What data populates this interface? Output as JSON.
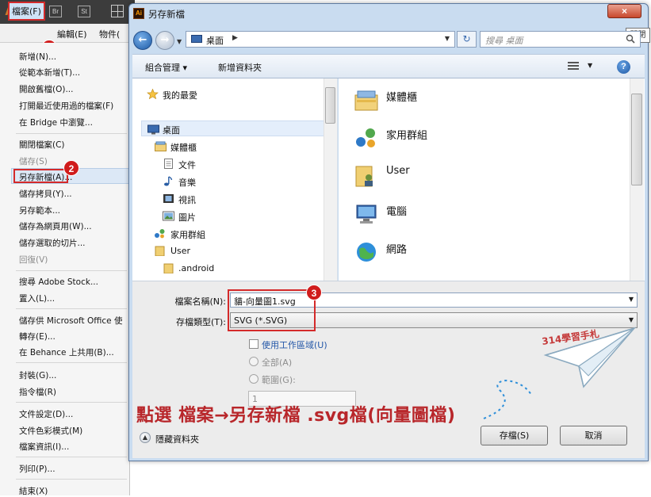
{
  "app": {
    "logo": "Ai",
    "badges": [
      "Br",
      "St"
    ],
    "menubar": [
      "檔案(F)",
      "編輯(E)",
      "物件("
    ]
  },
  "file_menu": {
    "items": [
      {
        "label": "新增(N)...",
        "enabled": true
      },
      {
        "label": "從範本新增(T)...",
        "enabled": true
      },
      {
        "label": "開啟舊檔(O)...",
        "enabled": true
      },
      {
        "label": "打開最近使用過的檔案(F)",
        "enabled": true
      },
      {
        "label": "在 Bridge 中瀏覽...",
        "enabled": true
      },
      {
        "label": "關閉檔案(C)",
        "enabled": true
      },
      {
        "label": "儲存(S)",
        "enabled": false
      },
      {
        "label": "另存新檔(A)...",
        "enabled": true
      },
      {
        "label": "儲存拷貝(Y)...",
        "enabled": true
      },
      {
        "label": "另存範本...",
        "enabled": true
      },
      {
        "label": "儲存為網頁用(W)...",
        "enabled": true
      },
      {
        "label": "儲存選取的切片...",
        "enabled": true
      },
      {
        "label": "回復(V)",
        "enabled": false
      },
      {
        "label": "搜尋 Adobe Stock...",
        "enabled": true
      },
      {
        "label": "置入(L)...",
        "enabled": true
      },
      {
        "label": "儲存供 Microsoft Office 使",
        "enabled": true
      },
      {
        "label": "轉存(E)...",
        "enabled": true
      },
      {
        "label": "在 Behance 上共用(B)...",
        "enabled": true
      },
      {
        "label": "封裝(G)...",
        "enabled": true
      },
      {
        "label": "指令檔(R)",
        "enabled": true
      },
      {
        "label": "文件設定(D)...",
        "enabled": true
      },
      {
        "label": "文件色彩模式(M)",
        "enabled": true
      },
      {
        "label": "檔案資訊(I)...",
        "enabled": true
      },
      {
        "label": "列印(P)...",
        "enabled": true
      },
      {
        "label": "結束(X)",
        "enabled": true
      }
    ]
  },
  "steps": [
    "1",
    "2",
    "3"
  ],
  "dialog": {
    "title": "另存新檔",
    "close_label": "×",
    "close_tooltip": "關閉",
    "address": "桌面",
    "search_placeholder": "搜尋 桌面",
    "toolbar": {
      "organize": "組合管理 ▾",
      "new_folder": "新增資料夾"
    },
    "nav_tree": [
      "我的最愛",
      "桌面",
      "媒體櫃",
      "文件",
      "音樂",
      "視訊",
      "圖片",
      "家用群組",
      "User",
      ".android"
    ],
    "files": [
      "媒體櫃",
      "家用群組",
      "User",
      "電腦",
      "網路"
    ],
    "filename_label": "檔案名稱(N):",
    "filename_value": "貓-向量圖1.svg",
    "filetype_label": "存檔類型(T):",
    "filetype_value": "SVG (*.SVG)",
    "use_artboards": "使用工作區域(U)",
    "radio_all": "全部(A)",
    "radio_range": "範圍(G):",
    "range_value": "1",
    "hide_folders": "隱藏資料夾",
    "save_button": "存檔(S)",
    "cancel_button": "取消"
  },
  "annotation": {
    "caption": "點選 檔案→另存新檔 .svg檔(向量圖檔)",
    "brand": "314學習手札"
  },
  "colors": {
    "accent_red": "#d42a2a",
    "caption_red": "#b8262a",
    "dialog_frame": "#c9dcf0"
  }
}
